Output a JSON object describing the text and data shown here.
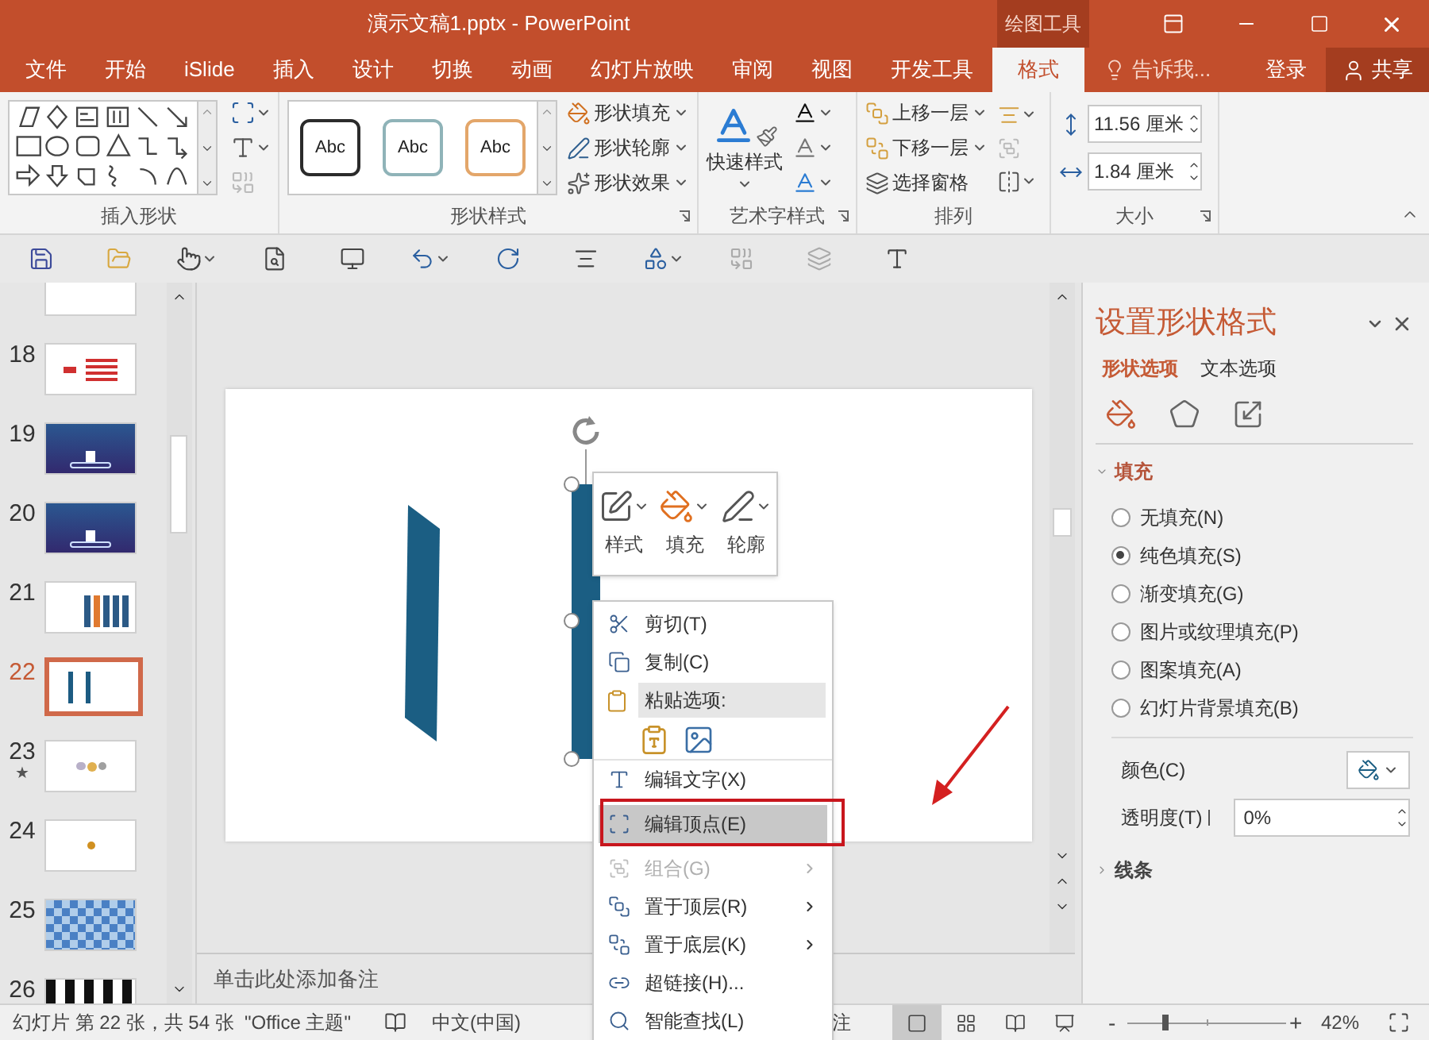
{
  "window": {
    "title": "演示文稿1.pptx - PowerPoint",
    "context_tab": "绘图工具"
  },
  "tabs": [
    {
      "label": "文件",
      "selected": false
    },
    {
      "label": "开始",
      "selected": false
    },
    {
      "label": "iSlide",
      "selected": false
    },
    {
      "label": "插入",
      "selected": false
    },
    {
      "label": "设计",
      "selected": false
    },
    {
      "label": "切换",
      "selected": false
    },
    {
      "label": "动画",
      "selected": false
    },
    {
      "label": "幻灯片放映",
      "selected": false
    },
    {
      "label": "审阅",
      "selected": false
    },
    {
      "label": "视图",
      "selected": false
    },
    {
      "label": "开发工具",
      "selected": false
    },
    {
      "label": "格式",
      "selected": true
    }
  ],
  "tell_me": "告诉我...",
  "sign_in": "登录",
  "share": "共享",
  "ribbon": {
    "insert_shapes": {
      "label": "插入形状"
    },
    "shape_styles": {
      "label": "形状样式",
      "presets": [
        {
          "text": "Abc",
          "color": "#2b2b2b"
        },
        {
          "text": "Abc",
          "color": "#8fb3b8"
        },
        {
          "text": "Abc",
          "color": "#e3a66a"
        }
      ],
      "commands": [
        {
          "kind": "fill",
          "label": "形状填充"
        },
        {
          "kind": "outline",
          "label": "形状轮廓"
        },
        {
          "kind": "effects",
          "label": "形状效果"
        }
      ]
    },
    "wordart": {
      "label": "艺术字样式",
      "quick_styles": "快速样式"
    },
    "arrange": {
      "label": "排列",
      "commands": [
        {
          "kind": "forward",
          "label": "上移一层"
        },
        {
          "kind": "backward",
          "label": "下移一层"
        },
        {
          "kind": "pane",
          "label": "选择窗格"
        }
      ]
    },
    "size": {
      "label": "大小",
      "height": "11.56 厘米",
      "width": "1.84 厘米"
    }
  },
  "slides": [
    {
      "kind": "blank",
      "selected": false
    },
    {
      "number": "18",
      "kind": "table",
      "selected": false
    },
    {
      "number": "19",
      "kind": "stage",
      "selected": false
    },
    {
      "number": "20",
      "kind": "stage",
      "selected": false
    },
    {
      "number": "21",
      "kind": "columns",
      "selected": false
    },
    {
      "number": "22",
      "kind": "bars",
      "selected": true
    },
    {
      "number": "23",
      "kind": "cluster",
      "selected": false,
      "animation_mark": "★"
    },
    {
      "number": "24",
      "kind": "dot",
      "selected": false
    },
    {
      "number": "25",
      "kind": "checker",
      "selected": false
    },
    {
      "number": "26",
      "kind": "strip",
      "selected": false
    }
  ],
  "notes_placeholder": "单击此处添加备注",
  "mini_toolbar": [
    {
      "kind": "style",
      "label": "样式"
    },
    {
      "kind": "fill",
      "label": "填充"
    },
    {
      "kind": "outline",
      "label": "轮廓"
    }
  ],
  "context_menu": [
    {
      "kind": "item",
      "label": "剪切(T)",
      "selected": false,
      "disabled": false,
      "submenu": false
    },
    {
      "kind": "item",
      "label": "复制(C)",
      "selected": false,
      "disabled": false,
      "submenu": false
    },
    {
      "kind": "header",
      "label": "粘贴选项:"
    },
    {
      "kind": "paste"
    },
    {
      "kind": "item",
      "label": "编辑文字(X)",
      "selected": false,
      "disabled": false,
      "submenu": false
    },
    {
      "kind": "item",
      "label": "编辑顶点(E)",
      "selected": true,
      "disabled": false,
      "submenu": false
    },
    {
      "kind": "item",
      "label": "组合(G)",
      "selected": false,
      "disabled": true,
      "submenu": true
    },
    {
      "kind": "item",
      "label": "置于顶层(R)",
      "selected": false,
      "disabled": false,
      "submenu": true
    },
    {
      "kind": "item",
      "label": "置于底层(K)",
      "selected": false,
      "disabled": false,
      "submenu": true
    },
    {
      "kind": "item",
      "label": "超链接(H)...",
      "selected": false,
      "disabled": false,
      "submenu": false
    },
    {
      "kind": "item",
      "label": "智能查找(L)",
      "selected": false,
      "disabled": false,
      "submenu": false
    }
  ],
  "format_pane": {
    "title": "设置形状格式",
    "tabs": [
      {
        "label": "形状选项",
        "selected": true
      },
      {
        "label": "文本选项",
        "selected": false
      }
    ],
    "categories": [
      {
        "selected": true
      },
      {
        "selected": false
      },
      {
        "selected": false
      }
    ],
    "fill_section": {
      "label": "填充",
      "expanded": true
    },
    "fill_options": [
      {
        "label": "无填充(N)",
        "selected": false
      },
      {
        "label": "纯色填充(S)",
        "selected": true
      },
      {
        "label": "渐变填充(G)",
        "selected": false
      },
      {
        "label": "图片或纹理填充(P)",
        "selected": false
      },
      {
        "label": "图案填充(A)",
        "selected": false
      },
      {
        "label": "幻灯片背景填充(B)",
        "selected": false
      }
    ],
    "color_label": "颜色(C)",
    "transparency_label": "透明度(T)",
    "transparency_slider": {
      "level": 0
    },
    "transparency": "0%",
    "line_section": {
      "label": "线条",
      "expanded": false
    }
  },
  "status_bar": {
    "slide_info": "幻灯片 第 22 张，共 54 张",
    "theme": "\"Office 主题\"",
    "language": "中文(中国)",
    "notes": "注",
    "views": [
      {
        "selected": true
      },
      {
        "selected": false
      },
      {
        "selected": false
      },
      {
        "selected": false
      }
    ],
    "zoom_minus": "-",
    "zoom": {
      "level": 0.22
    },
    "zoom_plus": "+",
    "zoom_text": "42%"
  }
}
